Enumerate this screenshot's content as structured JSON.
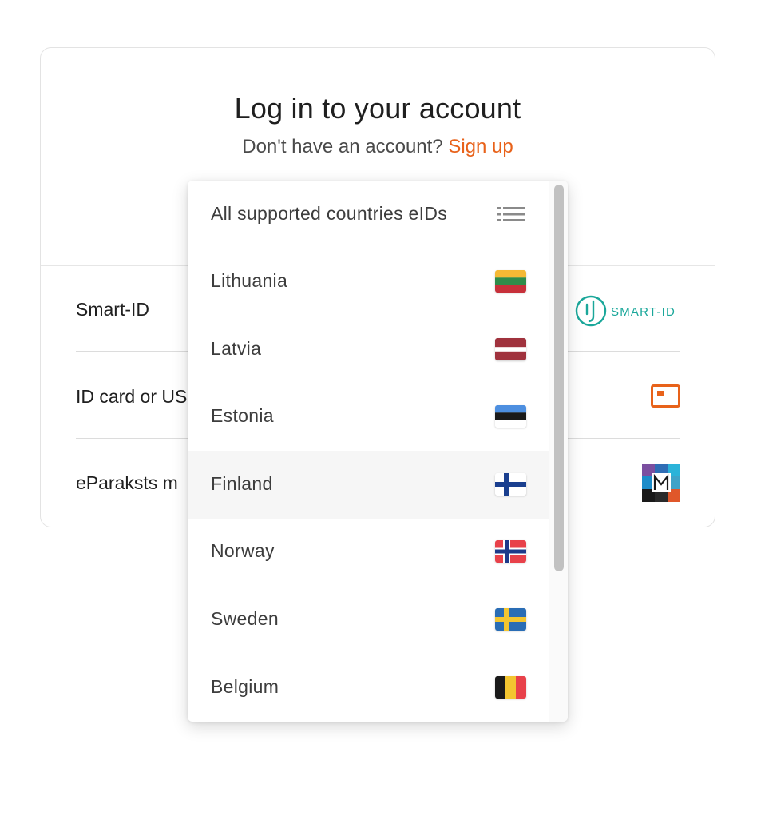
{
  "header": {
    "title": "Log in to your account",
    "subtitle_text": "Don't have an account?",
    "signup_link": "Sign up"
  },
  "methods": [
    {
      "label": "Smart-ID",
      "logo_text": "SMART-ID",
      "icon": "smart-id-logo"
    },
    {
      "label": "ID card or US",
      "icon": "id-card-icon"
    },
    {
      "label": "eParaksts m",
      "icon": "eparaksts-icon"
    }
  ],
  "dropdown": {
    "selected_index": 4,
    "items": [
      {
        "label": "All supported countries eIDs",
        "icon": "list-icon"
      },
      {
        "label": "Lithuania",
        "icon": "flag-lithuania"
      },
      {
        "label": "Latvia",
        "icon": "flag-latvia"
      },
      {
        "label": "Estonia",
        "icon": "flag-estonia"
      },
      {
        "label": "Finland",
        "icon": "flag-finland"
      },
      {
        "label": "Norway",
        "icon": "flag-norway"
      },
      {
        "label": "Sweden",
        "icon": "flag-sweden"
      },
      {
        "label": "Belgium",
        "icon": "flag-belgium"
      }
    ]
  },
  "colors": {
    "accent": "#e8621a",
    "smart_id_teal": "#1aa79a"
  }
}
